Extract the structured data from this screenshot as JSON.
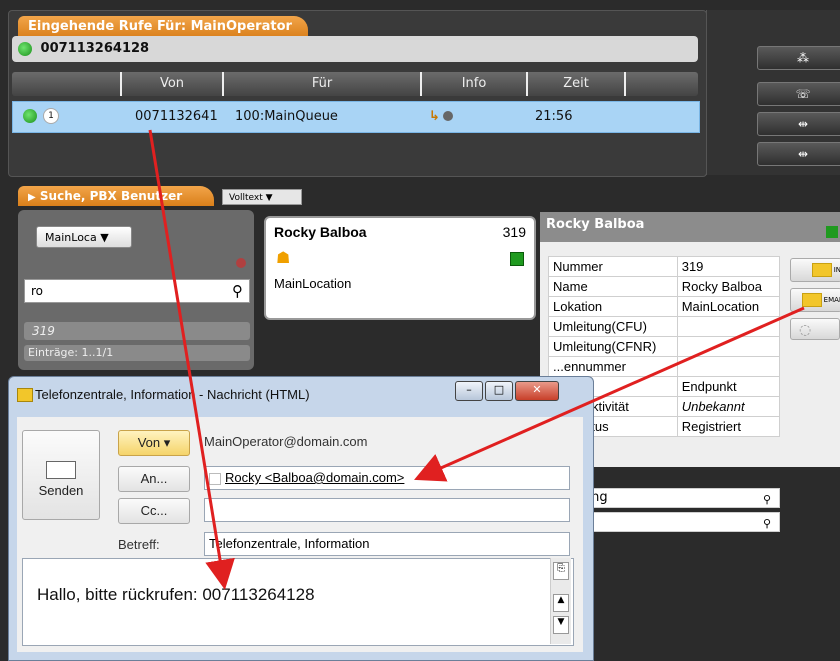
{
  "incoming": {
    "title": "Eingehende Rufe Für: MainOperator",
    "number": "007113264128",
    "columns": [
      "Von",
      "Für",
      "Info",
      "Zeit"
    ],
    "call": {
      "badge": "1",
      "from": "0071132641",
      "for": "100:MainQueue",
      "time": "21:56"
    }
  },
  "search": {
    "title": "Suche, PBX Benutzer",
    "mode": "Volltext",
    "location_select": "MainLoca",
    "query": "ro",
    "result_number": "319",
    "entries": "Einträge: 1..1/1"
  },
  "card": {
    "name": "Rocky Balboa",
    "ext": "319",
    "location": "MainLocation"
  },
  "details": {
    "name": "Rocky Balboa",
    "rows": [
      {
        "label": "Nummer",
        "value": "319"
      },
      {
        "label": "Name",
        "value": "Rocky Balboa"
      },
      {
        "label": "Lokation",
        "value": "MainLocation"
      },
      {
        "label": "Umleitung(CFU)",
        "value": ""
      },
      {
        "label": "Umleitung(CFNR)",
        "value": ""
      },
      {
        "label": "...ennummer",
        "value": ""
      },
      {
        "label": "...kttyp",
        "value": "Endpunkt"
      },
      {
        "label": "...enzaktivität",
        "value": "Unbekannt"
      },
      {
        "label": "...ktstatus",
        "value": "Registriert"
      }
    ],
    "extra1": "...keting",
    "side_btn1": "IN",
    "side_btn2": "EMAI"
  },
  "dialog": {
    "title": "Telefonzentrale, Information - Nachricht (HTML)",
    "send_label": "Senden",
    "from_label": "Von ▾",
    "from_value": "MainOperator@domain.com",
    "to_label": "An...",
    "to_value": "Rocky <Balboa@domain.com>",
    "cc_label": "Cc...",
    "subject_label": "Betreff:",
    "subject_value": "Telefonzentrale, Information",
    "body": "Hallo, bitte rückrufen: 007113264128"
  },
  "colors": {
    "orange": "#e8942f",
    "selection": "#a9d4f5",
    "arrow": "#e02020"
  }
}
